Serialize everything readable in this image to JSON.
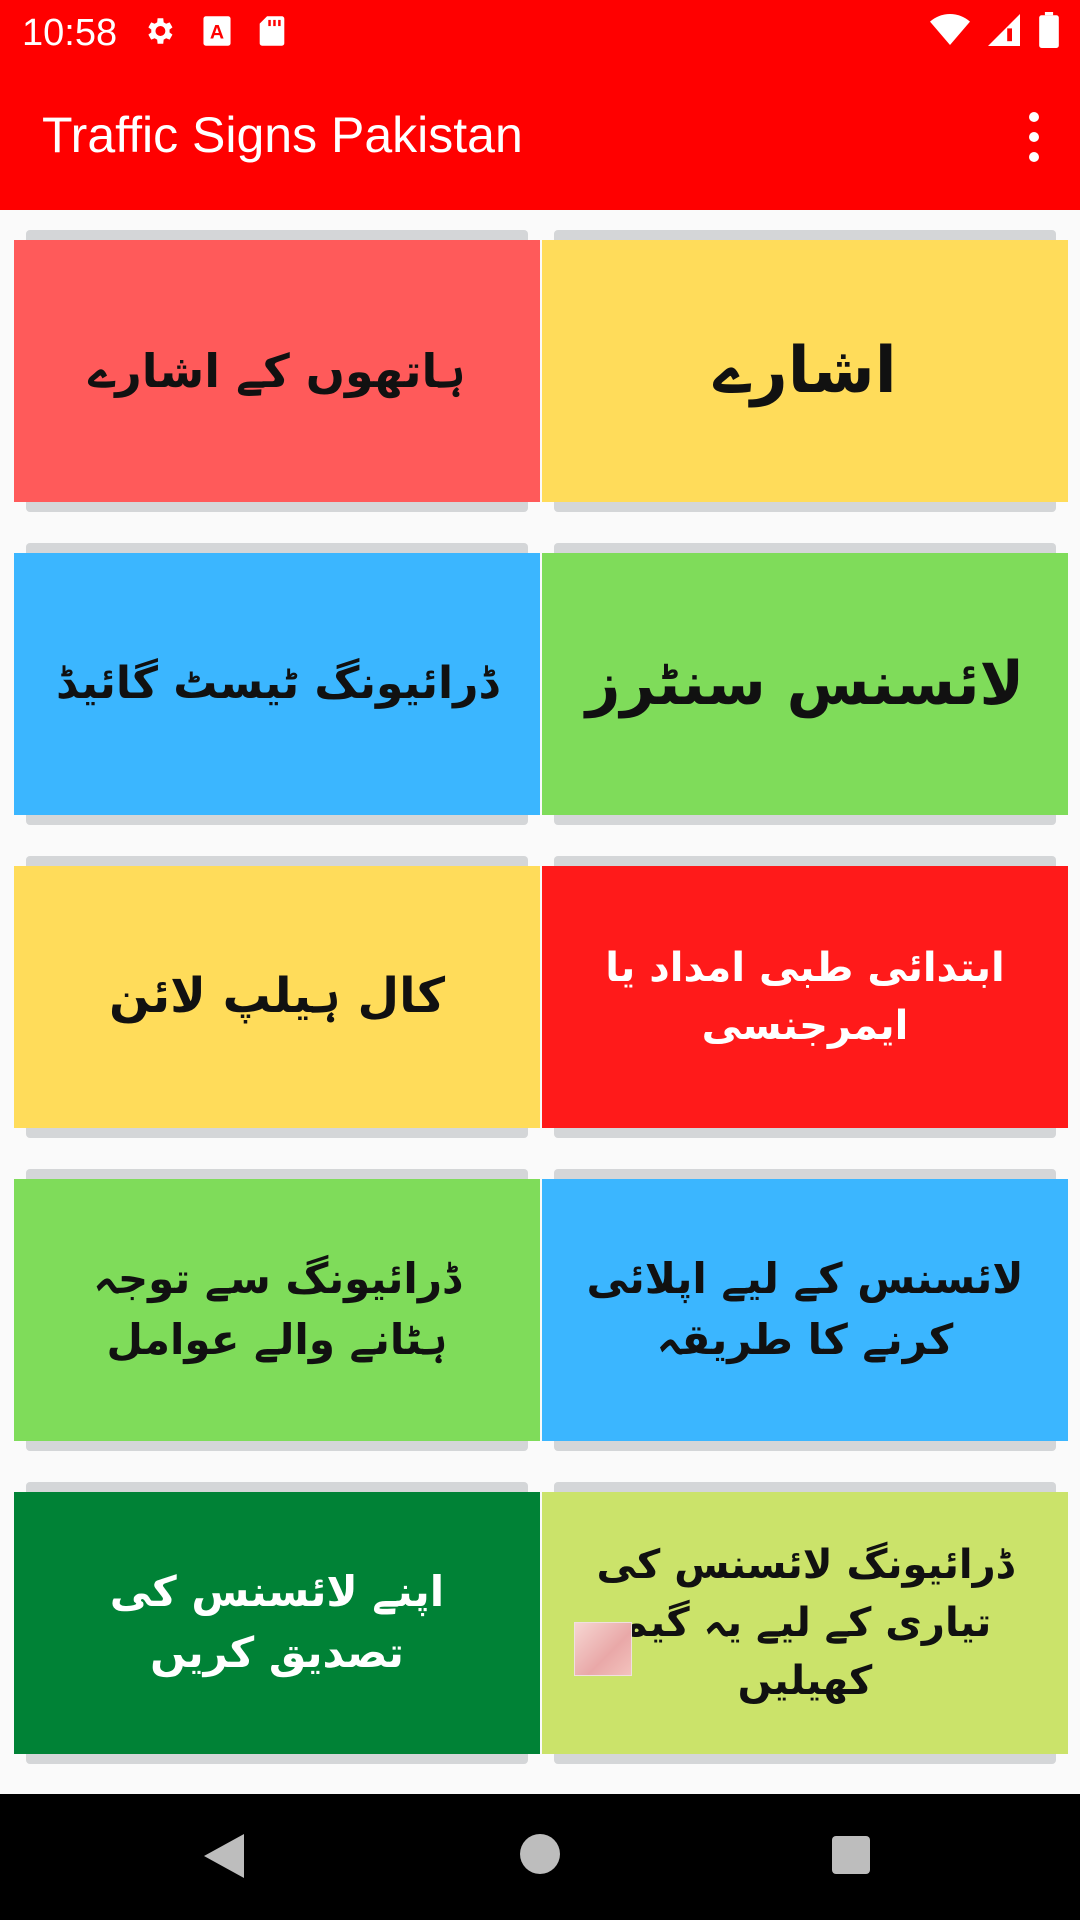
{
  "status_bar": {
    "time": "10:58",
    "left_icons": [
      "gear-icon",
      "a-badge-icon",
      "sd-card-icon"
    ],
    "right_icons": [
      "wifi-icon",
      "signal-icon",
      "battery-icon"
    ]
  },
  "app_bar": {
    "title": "Traffic Signs Pakistan",
    "menu_icon": "overflow-menu-icon",
    "color": "#ff0000"
  },
  "cards": [
    {
      "label": "ہاتھوں کے اشارے",
      "color": "#ff5a5a",
      "text_color": "#111111"
    },
    {
      "label": "اشارے",
      "color": "#ffdc5a",
      "text_color": "#111111"
    },
    {
      "label": "ڈرائیونگ ٹیسٹ گائیڈ",
      "color": "#3bb6ff",
      "text_color": "#111111"
    },
    {
      "label": "لائسنس سنٹرز",
      "color": "#7fdc5a",
      "text_color": "#111111"
    },
    {
      "label": "کال ہیلپ لائن",
      "color": "#ffdc5a",
      "text_color": "#111111"
    },
    {
      "label": "ابتدائی طبی امداد یا ایمرجنسی",
      "color": "#ff1a1a",
      "text_color": "#ffffff"
    },
    {
      "label": "ڈرائیونگ سے توجہ ہٹانے والے عوامل",
      "color": "#7fdc5a",
      "text_color": "#111111"
    },
    {
      "label": "لائسنس کے لیے اپلائی کرنے کا طریقہ",
      "color": "#3bb6ff",
      "text_color": "#111111"
    },
    {
      "label": "اپنے لائسنس کی تصدیق کریں",
      "color": "#008236",
      "text_color": "#ffffff"
    },
    {
      "label": "ڈرائیونگ لائسنس کی تیاری کے لیے یہ گیم کھیلیں",
      "color": "#cbe36a",
      "text_color": "#111111"
    }
  ],
  "nav_bar": {
    "icons": [
      "back-icon",
      "home-icon",
      "recents-icon"
    ]
  }
}
